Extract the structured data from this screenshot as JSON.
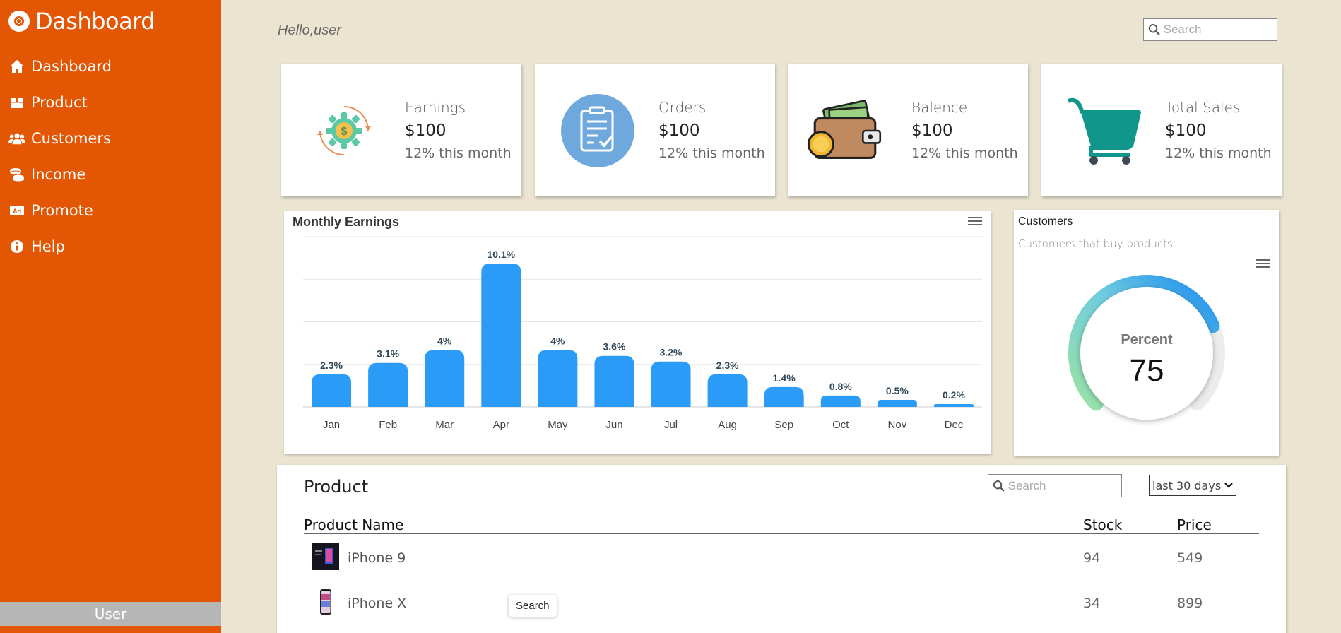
{
  "sidebar": {
    "brand": "Dashboard",
    "items": [
      {
        "label": "Dashboard"
      },
      {
        "label": "Product"
      },
      {
        "label": "Customers"
      },
      {
        "label": "Income"
      },
      {
        "label": "Promote"
      },
      {
        "label": "Help"
      }
    ],
    "user_label": "User",
    "color": "#e35604"
  },
  "header": {
    "greeting": "Hello,user",
    "search_placeholder": "Search"
  },
  "cards": [
    {
      "label": "Earnings",
      "value": "$100",
      "sub": "12% this month",
      "icon": "gear-dollar-icon"
    },
    {
      "label": "Orders",
      "value": "$100",
      "sub": "12% this month",
      "icon": "clipboard-check-icon"
    },
    {
      "label": "Balence",
      "value": "$100",
      "sub": "12% this month",
      "icon": "wallet-icon"
    },
    {
      "label": "Total Sales",
      "value": "$100",
      "sub": "12% this month",
      "icon": "cart-icon"
    }
  ],
  "chart_data": {
    "type": "bar",
    "title": "Monthly Earnings",
    "categories": [
      "Jan",
      "Feb",
      "Mar",
      "Apr",
      "May",
      "Jun",
      "Jul",
      "Aug",
      "Sep",
      "Oct",
      "Nov",
      "Dec"
    ],
    "values": [
      2.3,
      3.1,
      4,
      10.1,
      4,
      3.6,
      3.2,
      2.3,
      1.4,
      0.8,
      0.5,
      0.2
    ],
    "data_labels": [
      "2.3%",
      "3.1%",
      "4%",
      "10.1%",
      "4%",
      "3.6%",
      "3.2%",
      "2.3%",
      "1.4%",
      "0.8%",
      "0.5%",
      "0.2%"
    ],
    "ylim": [
      0,
      12
    ],
    "grid": true,
    "color": "#2b9bf8"
  },
  "customers": {
    "title": "Customers",
    "subtitle": "Customers that buy products",
    "gauge_label": "Percent",
    "gauge_value": "75",
    "gauge_fraction": 0.75
  },
  "product": {
    "title": "Product",
    "search_placeholder": "Search",
    "range_selected": "last 30 days",
    "columns": [
      "Product Name",
      "Stock",
      "Price"
    ],
    "rows": [
      {
        "name": "iPhone 9",
        "stock": "94",
        "price": "549"
      },
      {
        "name": "iPhone X",
        "stock": "34",
        "price": "899"
      }
    ]
  },
  "tooltip": "Search"
}
